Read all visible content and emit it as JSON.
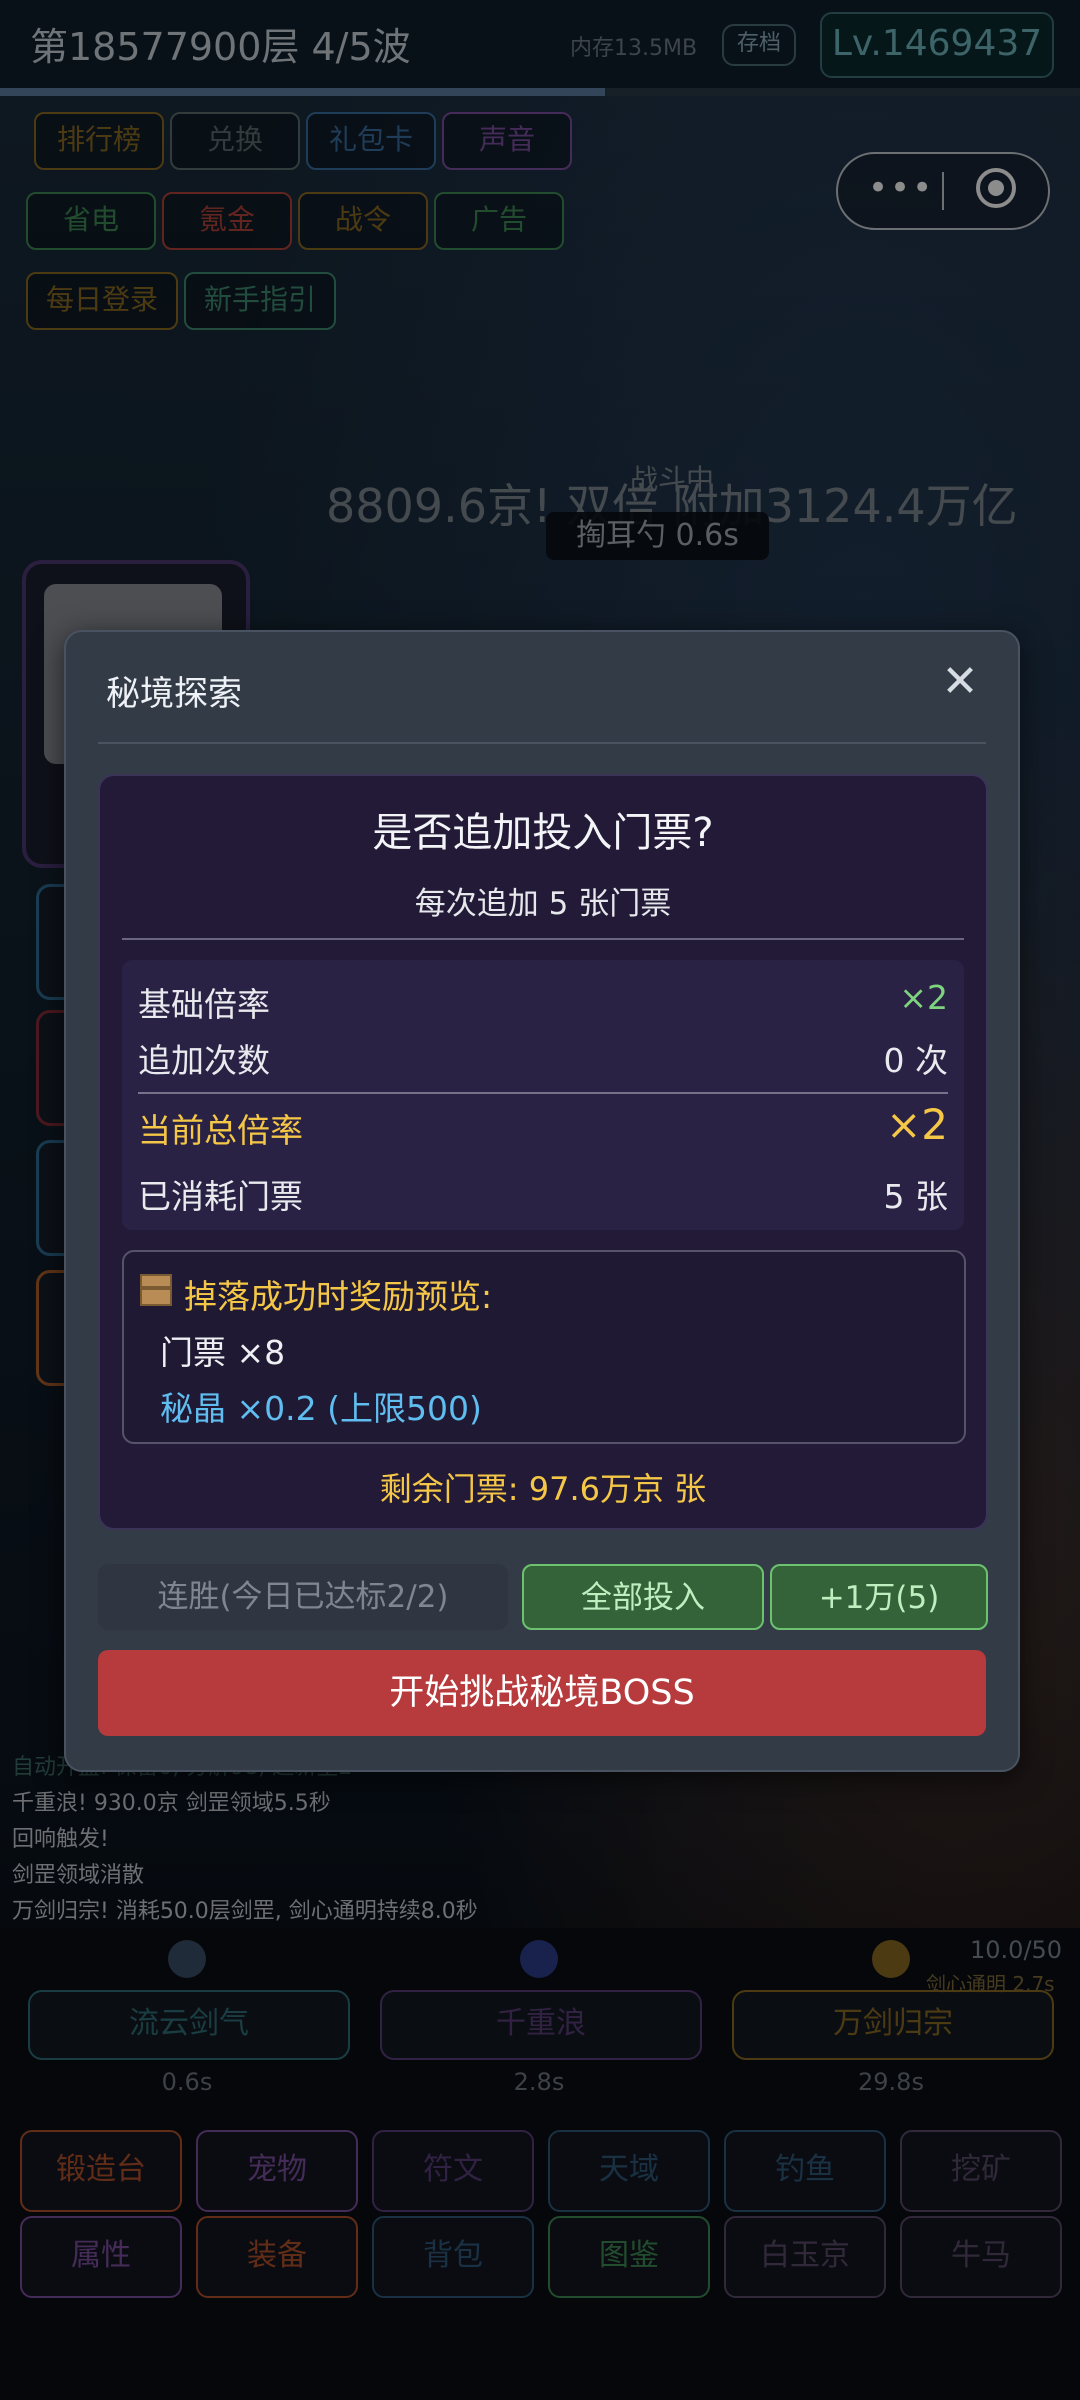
{
  "topbar": {
    "floor_wave": "第18577900层  4/5波",
    "memory": "内存13.5MB",
    "save_label": "存档",
    "level": "Lv.1469437",
    "wave_progress": 0.56
  },
  "menu": [
    {
      "label": "排行榜",
      "color": "#8a6b22"
    },
    {
      "label": "兑换",
      "color": "#5b6e70"
    },
    {
      "label": "礼包卡",
      "color": "#3a6fa0"
    },
    {
      "label": "声音",
      "color": "#7f4fa0"
    },
    {
      "label": "省电",
      "color": "#3f8a55"
    },
    {
      "label": "氪金",
      "color": "#b2423a"
    },
    {
      "label": "战令",
      "color": "#8a6b22"
    },
    {
      "label": "广告",
      "color": "#3f8a55"
    },
    {
      "label": "每日登录",
      "color": "#8a6b22"
    },
    {
      "label": "新手指引",
      "color": "#3f8a6f"
    }
  ],
  "battle": {
    "damage_text": "8809.6京! 双倍 附加3124.4万亿",
    "status": "战斗中",
    "skill_timer": "掏耳勺 0.6s"
  },
  "dialog": {
    "title": "秘境探索",
    "question": "是否追加投入门票?",
    "subtitle": "每次追加 5 张门票",
    "stats": [
      {
        "label": "基础倍率",
        "value": "×2"
      },
      {
        "label": "追加次数",
        "value": "0 次"
      },
      {
        "label": "当前总倍率",
        "value": "×2"
      },
      {
        "label": "已消耗门票",
        "value": "5 张"
      }
    ],
    "reward_title": "掉落成功时奖励预览:",
    "rewards": [
      "门票 ×8",
      "秘晶 ×0.2 (上限500)"
    ],
    "remaining": "剩余门票: 97.6万京 张",
    "streak_label": "连胜(今日已达标2/2)",
    "all_in_label": "全部投入",
    "add_label": "+1万(5)",
    "start_label": "开始挑战秘境BOSS"
  },
  "log": [
    "自动开盒: 保留0, 分解98, 超新星2",
    "千重浪! 930.0京 剑罡领域5.5秒",
    "回响触发!",
    "剑罡领域消散",
    "万剑归宗! 消耗50.0层剑罡, 剑心通明持续8.0秒"
  ],
  "skills": [
    {
      "name": "流云剑气",
      "time": "0.6s",
      "color": "#2f6f78"
    },
    {
      "name": "千重浪",
      "time": "2.8s",
      "color": "#5a3c7a"
    },
    {
      "name": "万剑归宗",
      "time": "29.8s",
      "color": "#8a6b22"
    }
  ],
  "skill_counter": "10.0/50",
  "skill_buff": "剑心通明 2.7s",
  "nav": [
    {
      "label": "锻造台",
      "color": "#b2522a"
    },
    {
      "label": "宠物",
      "color": "#7f4fa0"
    },
    {
      "label": "符文",
      "color": "#5a3c7a"
    },
    {
      "label": "天域",
      "color": "#2f5a7a"
    },
    {
      "label": "钓鱼",
      "color": "#2f5a7a"
    },
    {
      "label": "挖矿",
      "color": "#5a4a6a"
    },
    {
      "label": "属性",
      "color": "#7f4fa0"
    },
    {
      "label": "装备",
      "color": "#b2522a"
    },
    {
      "label": "背包",
      "color": "#2f5a7a"
    },
    {
      "label": "图鉴",
      "color": "#3f8a55"
    },
    {
      "label": "白玉京",
      "color": "#5a4a6a"
    },
    {
      "label": "牛马",
      "color": "#5a4a6a"
    }
  ]
}
